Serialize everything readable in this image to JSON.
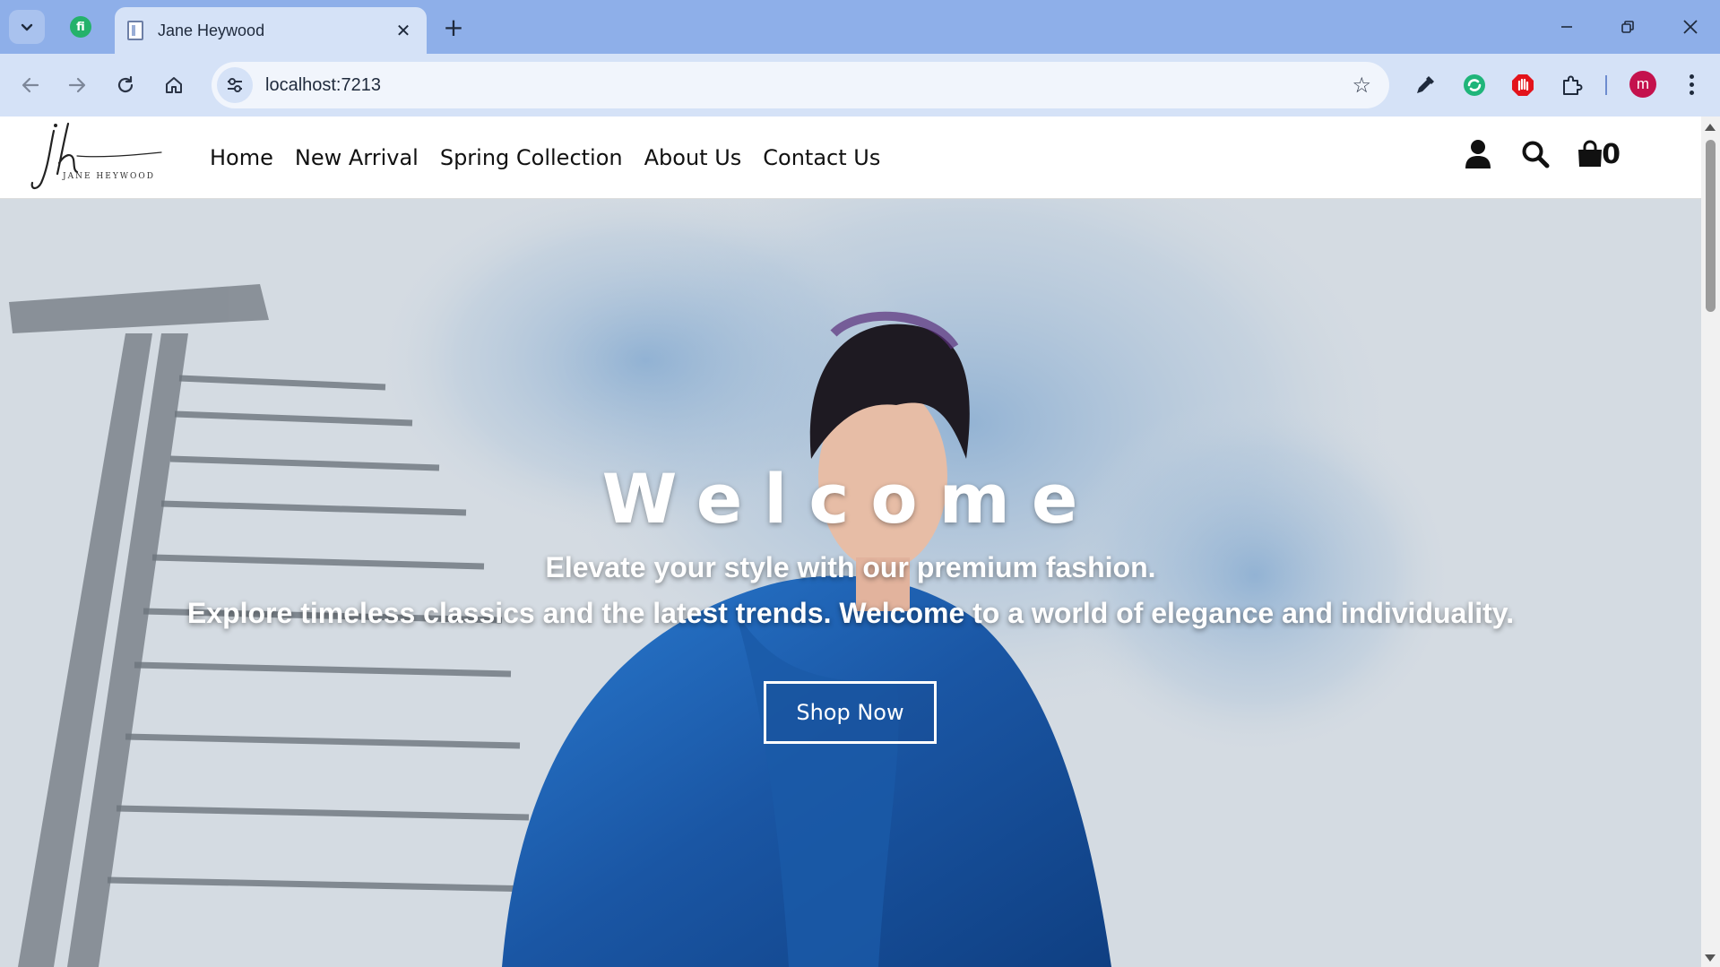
{
  "browser": {
    "tab_title": "Jane Heywood",
    "url": "localhost:7213",
    "profile_initial": "m",
    "new_tab_symbol": "+",
    "close_symbol": "✕"
  },
  "site": {
    "logo": {
      "monogram": "jh",
      "wordmark": "JANE HEYWOOD"
    },
    "nav": [
      {
        "label": "Home"
      },
      {
        "label": "New Arrival"
      },
      {
        "label": "Spring Collection"
      },
      {
        "label": "About Us"
      },
      {
        "label": "Contact Us"
      }
    ],
    "cart_count": "0"
  },
  "hero": {
    "title": "Welcome",
    "subtitle_line1": "Elevate your style with our premium fashion.",
    "subtitle_line2": "Explore timeless classics and the latest trends. Welcome to a world of elegance and individuality.",
    "cta_label": "Shop Now"
  },
  "icons": {
    "user": "user-icon",
    "search": "search-icon",
    "cart": "shopping-bag-icon"
  },
  "colors": {
    "chrome_tabstrip": "#8eafe9",
    "chrome_toolbar": "#d5e2f7",
    "jacket_blue": "#1d63b8",
    "profile": "#c4124d"
  }
}
